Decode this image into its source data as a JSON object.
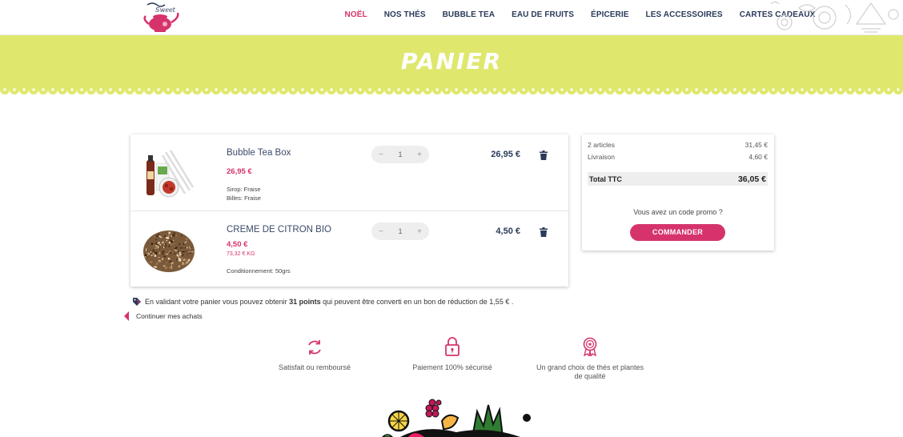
{
  "header": {
    "logo_icon": "teapot-logo-icon",
    "logo_text": "Sweet",
    "nav": [
      {
        "label": "NOËL",
        "active": true
      },
      {
        "label": "NOS THÉS",
        "active": false
      },
      {
        "label": "BUBBLE TEA",
        "active": false
      },
      {
        "label": "EAU DE FRUITS",
        "active": false
      },
      {
        "label": "ÉPICERIE",
        "active": false
      },
      {
        "label": "LES ACCESSOIRES",
        "active": false
      },
      {
        "label": "CARTES CADEAUX",
        "active": false
      }
    ]
  },
  "banner": {
    "title": "PANIER",
    "color": "#dfe86d"
  },
  "cart": {
    "items": [
      {
        "name": "Bubble Tea Box",
        "price": "26,95 €",
        "unit_price": "",
        "options": [
          "Sirop: Fraise",
          "Billes: Fraise"
        ],
        "quantity": "1",
        "total": "26,95 €"
      },
      {
        "name": "CREME DE CITRON BIO",
        "price": "4,50 €",
        "unit_price": "73,32 € KG",
        "options": [
          "Conditionnement: 50grs"
        ],
        "quantity": "1",
        "total": "4,50 €"
      }
    ],
    "qty_minus": "−",
    "qty_plus": "+"
  },
  "summary": {
    "articles_label": "2 articles",
    "articles_value": "31,45 €",
    "shipping_label": "Livraison",
    "shipping_value": "4,60 €",
    "total_label": "Total TTC",
    "total_value": "36,05 €",
    "promo_text": "Vous avez un code promo ?",
    "order_button": "COMMANDER"
  },
  "points": {
    "before": "En validant votre panier vous pouvez obtenir",
    "points": "31 points",
    "after": "qui peuvent être converti en un bon de réduction de 1,55 € ."
  },
  "continue_label": "Continuer mes achats",
  "features": [
    {
      "icon": "refresh-icon",
      "label": "Satisfait ou remboursé"
    },
    {
      "icon": "padlock-icon",
      "label": "Paiement 100% sécurisé"
    },
    {
      "icon": "award-ribbon-icon",
      "label": "Un grand choix de thés et plantes de qualité"
    }
  ],
  "colors": {
    "accent": "#d6336c",
    "navy": "#2b3a5a",
    "banner": "#dfe86d"
  }
}
